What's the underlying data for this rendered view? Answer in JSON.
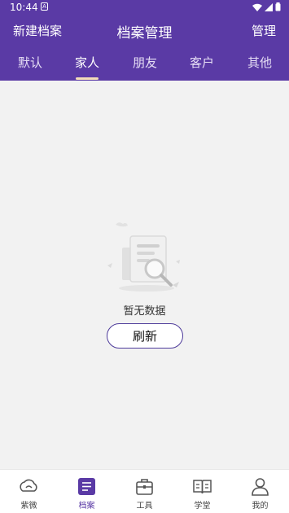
{
  "status": {
    "time": "10:44",
    "badge": "A"
  },
  "nav": {
    "left": "新建档案",
    "title": "档案管理",
    "right": "管理"
  },
  "tabs": [
    {
      "label": "默认"
    },
    {
      "label": "家人",
      "active": true
    },
    {
      "label": "朋友"
    },
    {
      "label": "客户"
    },
    {
      "label": "其他"
    }
  ],
  "empty": {
    "text": "暂无数据",
    "refresh": "刷新"
  },
  "bottom_nav": [
    {
      "label": "紫微",
      "icon": "cloud-icon"
    },
    {
      "label": "档案",
      "icon": "archive-icon",
      "active": true
    },
    {
      "label": "工具",
      "icon": "toolbox-icon"
    },
    {
      "label": "学堂",
      "icon": "book-icon"
    },
    {
      "label": "我的",
      "icon": "person-icon"
    }
  ],
  "colors": {
    "primary": "#5a3aa5",
    "indicator": "#f3ddb8",
    "background": "#f2f2f2"
  }
}
